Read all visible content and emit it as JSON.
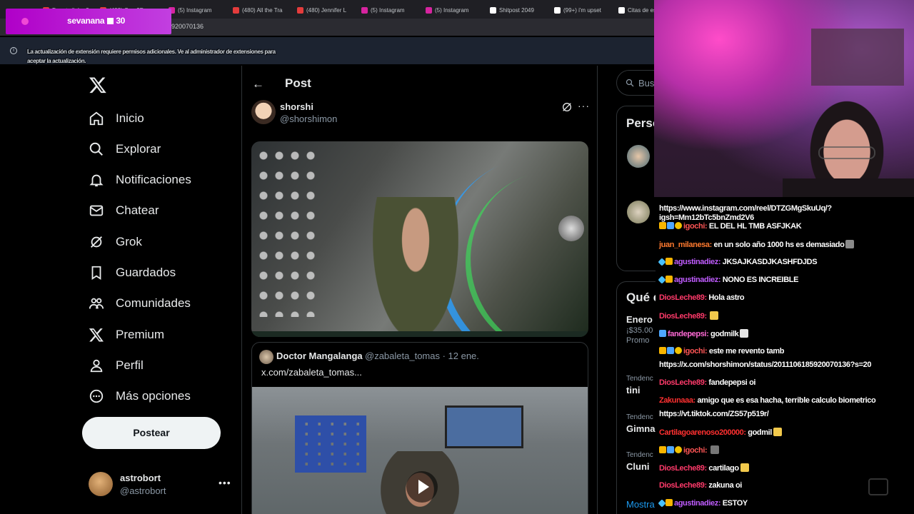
{
  "browser": {
    "tabs": [
      {
        "label": "Donate link ¿?",
        "color": "#e43c3c"
      },
      {
        "label": "(480) Gen 3D",
        "color": "#e43c3c"
      },
      {
        "label": "(5) Instagram",
        "color": "#d6249f"
      },
      {
        "label": "(480) All the Tra",
        "color": "#e43c3c"
      },
      {
        "label": "(480) Jennifer L",
        "color": "#e43c3c"
      },
      {
        "label": "(5) Instagram",
        "color": "#d6249f"
      },
      {
        "label": "(5) Instagram",
        "color": "#d6249f"
      },
      {
        "label": "Shitpost 2049",
        "color": "#ffffff"
      },
      {
        "label": "(99+) i'm upset",
        "color": "#ffffff"
      },
      {
        "label": "Citas de es",
        "color": "#ffffff"
      }
    ],
    "url_tail": "920070136",
    "info_message": "La actualización de extensión requiere permisos adicionales. Ve al administrador de extensiones para aceptar la actualización."
  },
  "sub_alert": {
    "user": "sevanana",
    "count": "30"
  },
  "sidebar": {
    "nav": [
      {
        "label": "Inicio",
        "icon": "home-icon"
      },
      {
        "label": "Explorar",
        "icon": "search-icon"
      },
      {
        "label": "Notificaciones",
        "icon": "bell-icon"
      },
      {
        "label": "Chatear",
        "icon": "mail-icon"
      },
      {
        "label": "Grok",
        "icon": "grok-icon"
      },
      {
        "label": "Guardados",
        "icon": "bookmark-icon"
      },
      {
        "label": "Comunidades",
        "icon": "people-icon"
      },
      {
        "label": "Premium",
        "icon": "x-icon"
      },
      {
        "label": "Perfil",
        "icon": "person-icon"
      },
      {
        "label": "Más opciones",
        "icon": "more-circle-icon"
      }
    ],
    "post_button": "Postear",
    "account": {
      "name": "astrobort",
      "handle": "@astrobort"
    }
  },
  "main": {
    "header_title": "Post",
    "author": {
      "name": "shorshi",
      "handle": "@shorshimon"
    },
    "quote": {
      "name": "Doctor Mangalanga",
      "meta": "@zabaleta_tomas · 12 ene.",
      "text": "x.com/zabaleta_tomas..."
    }
  },
  "right": {
    "search_placeholder": "Busc",
    "who_to_follow_title": "Perso",
    "trends_title": "Qué e",
    "trends": [
      {
        "category": "",
        "title": "Enero e",
        "sub": "¡$35.00",
        "extra": "Promo"
      },
      {
        "category": "Tendenc",
        "title": "tini",
        "sub": ""
      },
      {
        "category": "Tendenc",
        "title": "Gimnas",
        "sub": ""
      },
      {
        "category": "Tendenc",
        "title": "Cluni",
        "sub": ""
      }
    ],
    "show_more": "Mostra"
  },
  "chat": {
    "messages": [
      {
        "user": "",
        "user_color": "#ffffff",
        "badges": [],
        "text": "https://www.instagram.com/reel/DTZGMgSkuUq/?igsh=Mm12bTc5bnZmd2V6"
      },
      {
        "user": "igochi",
        "user_color": "#ff5555",
        "badges": [
          "crown",
          "sub",
          "gold"
        ],
        "text": "EL DEL HL TMB ASFJKAK"
      },
      {
        "user": "juan_milanesa",
        "user_color": "#ff7a2f",
        "badges": [],
        "text": "en un solo año 1000 hs es demasiado",
        "emote": "#8a8a8a"
      },
      {
        "user": "agustinadiez",
        "user_color": "#c05cff",
        "badges": [
          "sword",
          "crown"
        ],
        "text": "JKSAJKASDJKASHFDJDS"
      },
      {
        "user": "agustinadiez",
        "user_color": "#c05cff",
        "badges": [
          "sword",
          "crown"
        ],
        "text": "NONO ES INCREIBLE"
      },
      {
        "user": "DiosLeche89",
        "user_color": "#ff3a6a",
        "badges": [],
        "text": "Hola astro"
      },
      {
        "user": "DiosLeche89",
        "user_color": "#ff3a6a",
        "badges": [],
        "text": "",
        "emote": "#f2c94c"
      },
      {
        "user": "fandepepsi",
        "user_color": "#ff6ad5",
        "badges": [
          "sub"
        ],
        "text": "godmilk",
        "emote": "#e6e6e6"
      },
      {
        "user": "igochi",
        "user_color": "#ff5555",
        "badges": [
          "crown",
          "sub",
          "gold"
        ],
        "text": "este me revento tamb"
      },
      {
        "user": "",
        "user_color": "#ffffff",
        "badges": [],
        "text": "https://x.com/shorshimon/status/2011106185920070136?s=20"
      },
      {
        "user": "DiosLeche89",
        "user_color": "#ff3a6a",
        "badges": [],
        "text": "fandepepsi oi"
      },
      {
        "user": "Zakunaaa",
        "user_color": "#ff3030",
        "badges": [],
        "text": "amigo que es esa hacha, terrible calculo biometrico"
      },
      {
        "user": "",
        "user_color": "#ffffff",
        "badges": [],
        "text": "https://vt.tiktok.com/ZS57p519r/"
      },
      {
        "user": "Cartilagoarenoso200000",
        "user_color": "#ff3030",
        "badges": [],
        "text": "godmil",
        "emote": "#f2c94c"
      },
      {
        "user": "igochi",
        "user_color": "#ff5555",
        "badges": [
          "crown",
          "sub",
          "gold"
        ],
        "text": "",
        "emote": "#777777"
      },
      {
        "user": "DiosLeche89",
        "user_color": "#ff3a6a",
        "badges": [],
        "text": "cartilago",
        "emote": "#f2c94c"
      },
      {
        "user": "DiosLeche89",
        "user_color": "#ff3a6a",
        "badges": [],
        "text": "zakuna oi"
      },
      {
        "user": "agustinadiez",
        "user_color": "#c05cff",
        "badges": [
          "sword",
          "crown"
        ],
        "text": "ESTOY"
      }
    ]
  }
}
